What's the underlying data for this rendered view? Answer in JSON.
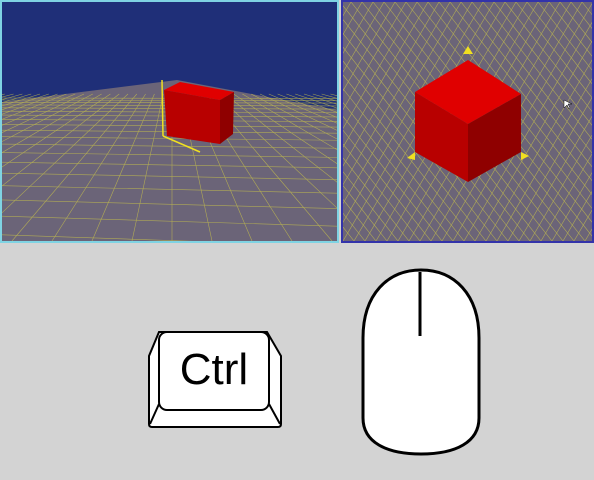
{
  "viewports": {
    "left": {
      "name": "perspective-viewport",
      "sky_color": "#1f2f78",
      "ground_color": "#6b6478",
      "grid_color": "#c8c24a",
      "cube_color": "#c80000"
    },
    "right": {
      "name": "top-perspective-viewport",
      "ground_color": "#6b6478",
      "grid_color": "#c8c24a",
      "cube_color": "#c80000",
      "active_border_color": "#3333aa"
    }
  },
  "input_hint": {
    "key_label": "Ctrl",
    "key_icon": "ctrl-key-icon",
    "mouse_icon": "mouse-icon"
  }
}
